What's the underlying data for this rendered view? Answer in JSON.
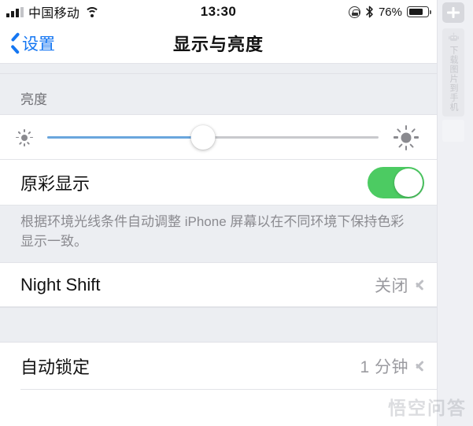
{
  "status_bar": {
    "carrier": "中国移动",
    "signal_icon": "cellular-signal-icon",
    "signal_bars_filled": 3,
    "signal_bars_total": 4,
    "wifi_icon": "wifi-icon",
    "time": "13:30",
    "rotation_lock_icon": "rotation-lock-icon",
    "bluetooth_icon": "bluetooth-icon",
    "battery_percent": "76%",
    "battery_level": 76,
    "battery_icon": "battery-icon"
  },
  "nav_bar": {
    "back_label": "设置",
    "back_icon": "chevron-left-icon",
    "title": "显示与亮度"
  },
  "brightness": {
    "section_header": "亮度",
    "slider_value": 47,
    "low_icon": "sun-small-icon",
    "high_icon": "sun-large-icon"
  },
  "true_tone": {
    "label": "原彩显示",
    "toggle_on": true,
    "toggle_color": "#4ccb62",
    "note": "根据环境光线条件自动调整 iPhone 屏幕以在不同环境下保持色彩显示一致。"
  },
  "night_shift": {
    "label": "Night Shift",
    "value": "关闭",
    "chevron_icon": "chevron-right-icon"
  },
  "auto_lock": {
    "label": "自动锁定",
    "value": "1 分钟",
    "chevron_icon": "chevron-right-icon"
  },
  "side_panel": {
    "add_button_icon": "plus-icon",
    "download_icon": "download-robot-icon",
    "download_label": "下载图片到手机"
  },
  "watermark": {
    "text": "悟空问答"
  },
  "colors": {
    "accent_blue": "#1476f2",
    "slider_fill": "#6aa6dd",
    "toggle_green": "#4ccb62",
    "group_bg": "#eceef2"
  }
}
